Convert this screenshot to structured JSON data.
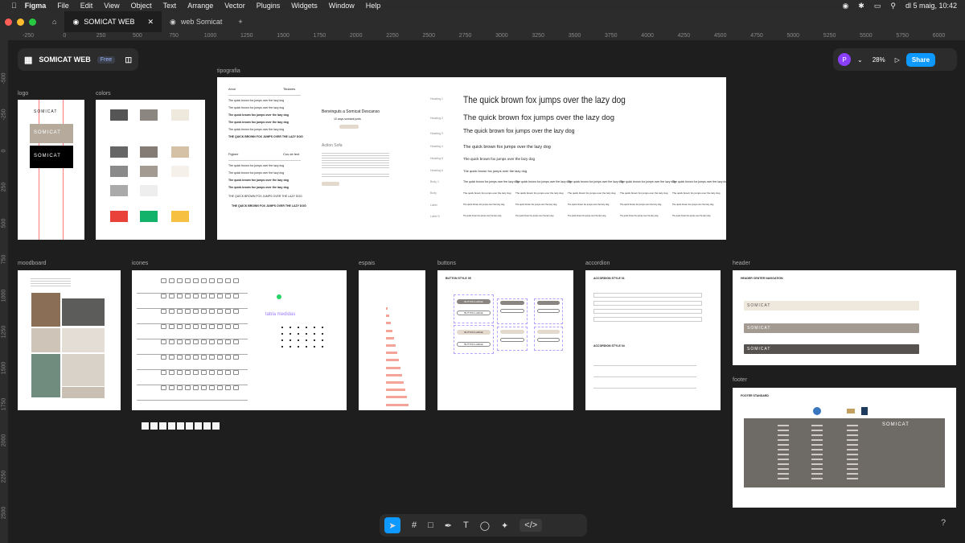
{
  "menubar": {
    "app": "Figma",
    "menus": [
      "File",
      "Edit",
      "View",
      "Object",
      "Text",
      "Arrange",
      "Vector",
      "Plugins",
      "Widgets",
      "Window",
      "Help"
    ],
    "clock": "dl 5 maig, 10:42"
  },
  "tabs": {
    "active": "SOMICAT WEB",
    "other": "web Somicat",
    "add": "+"
  },
  "ruler": {
    "top": [
      "-250",
      "0",
      "250",
      "500",
      "750",
      "1000",
      "1250",
      "1500",
      "1750",
      "2000",
      "2250",
      "2500",
      "2750",
      "3000",
      "3250",
      "3500",
      "3750",
      "4000",
      "4250",
      "4500",
      "4750",
      "5000",
      "5250",
      "5500",
      "5750",
      "6000"
    ],
    "left": [
      "-500",
      "-250",
      "0",
      "250",
      "500",
      "750",
      "1000",
      "1250",
      "1500",
      "1750",
      "2000",
      "2250",
      "2500"
    ]
  },
  "file": {
    "name": "SOMICAT WEB",
    "plan": "Free"
  },
  "topright": {
    "avatar": "P",
    "zoom": "28%",
    "share": "Share"
  },
  "frames": {
    "logo": "logo",
    "colors": "colors",
    "tipografia": "tipografia",
    "moodboard": "moodboard",
    "icones": "icones",
    "espais": "espais",
    "buttons": "buttons",
    "accordion": "accordion",
    "header": "header",
    "footer": "footer"
  },
  "logo": {
    "brand": "SOMICAT"
  },
  "typography": {
    "col1_header_a": "Arvoí",
    "col1_header_b": "Titulares",
    "col1_samples": [
      "The quick brown fox jumps over the lazy dog",
      "The quick brown fox jumps over the lazy dog",
      "The quick brown fox jumps over the lazy dog",
      "The quick brown fox jumps over the lazy dog",
      "The quick brown fox jumps over the lazy dog",
      "THE QUICK BROWN FOX JUMPS OVER THE LAZY DOG"
    ],
    "col1_header_c": "Figtree",
    "col1_header_d": "Cos de text",
    "col2_heading": "Benvinguts a Somicat Descanso",
    "col2_caption": "10 anys somiant junts",
    "col2_section": "Action Sofa",
    "headings": [
      "Heading 1",
      "Heading 2",
      "Heading 3",
      "Heading 4",
      "Heading 5",
      "Heading 6",
      "Body 1",
      "Body",
      "Label",
      "Label S"
    ],
    "sample": "The quick brown fox jumps over the lazy dog"
  },
  "icones": {
    "tabla": "tabla medidas"
  },
  "buttons": {
    "title": "BUTTON STYLE 05",
    "labels": [
      "BUTTON LARGE",
      "BUTTON LARGE",
      "BUTTON LARGE",
      "BUTTON LARGE"
    ]
  },
  "accordion": {
    "title1": "ACCORDION STYLE 01",
    "title2": "ACCORDION STYLE 04"
  },
  "header": {
    "title": "HEADER CENTER NAVIGATION",
    "brand": "SOMICAT"
  },
  "footer": {
    "title": "FOOTER STANDARD",
    "brand": "SOMICAT"
  },
  "bottom": {
    "help": "?"
  },
  "colors": {
    "accent": "#0d99ff",
    "red": "#e8423a",
    "green": "#13b26b",
    "yellow": "#f6c142",
    "beige": "#b5aa9c",
    "grey": "#6e6b67",
    "dark": "#595652"
  }
}
